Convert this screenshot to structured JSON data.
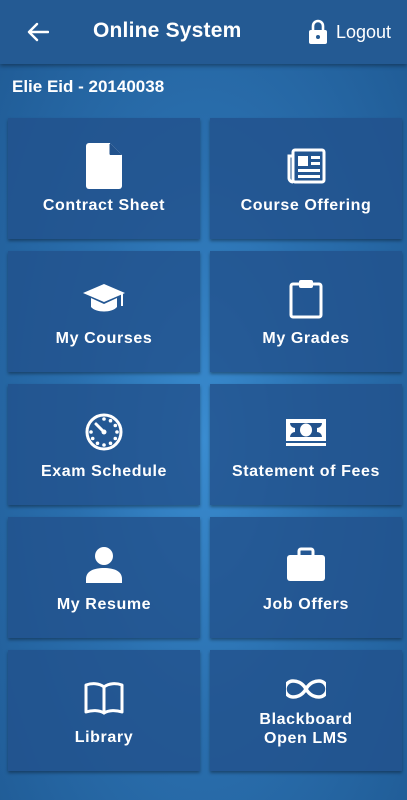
{
  "header": {
    "title": "Online System",
    "logout_label": "Logout"
  },
  "user": {
    "display": "Elie Eid - 20140038"
  },
  "tiles": [
    {
      "label": "Contract Sheet",
      "icon": "file-icon"
    },
    {
      "label": "Course Offering",
      "icon": "newspaper-icon"
    },
    {
      "label": "My Courses",
      "icon": "graduation-cap-icon"
    },
    {
      "label": "My Grades",
      "icon": "clipboard-icon"
    },
    {
      "label": "Exam Schedule",
      "icon": "clock-icon"
    },
    {
      "label": "Statement of Fees",
      "icon": "money-icon"
    },
    {
      "label": "My Resume",
      "icon": "person-icon"
    },
    {
      "label": "Job Offers",
      "icon": "briefcase-icon"
    },
    {
      "label": "Library",
      "icon": "book-icon"
    },
    {
      "label": "Blackboard\nOpen LMS",
      "icon": "infinity-icon"
    }
  ],
  "colors": {
    "appbar": "#245a93",
    "tile": "#22528c",
    "text": "#ffffff"
  }
}
